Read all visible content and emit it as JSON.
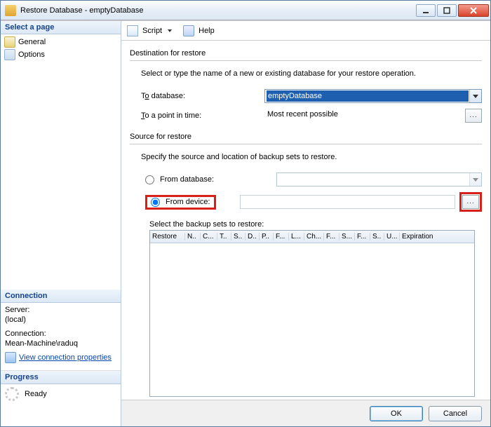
{
  "title": "Restore Database - emptyDatabase",
  "sidebar": {
    "header": "Select a page",
    "items": [
      {
        "label": "General"
      },
      {
        "label": "Options"
      }
    ]
  },
  "connection": {
    "header": "Connection",
    "server_label": "Server:",
    "server_value": "(local)",
    "conn_label": "Connection:",
    "conn_value": "Mean-Machine\\raduq",
    "view_props": "View connection properties"
  },
  "progress": {
    "header": "Progress",
    "status": "Ready"
  },
  "toolbar": {
    "script": "Script",
    "help": "Help"
  },
  "dest": {
    "section": "Destination for restore",
    "instr": "Select or type the name of a new or existing database for your restore operation.",
    "todb_label_pre": "T",
    "todb_label_u": "o",
    "todb_label_post": " database:",
    "todb_value": "emptyDatabase",
    "topit_label_pre": "",
    "topit_label_u": "T",
    "topit_label_post": "o a point in time:",
    "topit_value": "Most recent possible"
  },
  "source": {
    "section": "Source for restore",
    "instr": "Specify the source and location of backup sets to restore.",
    "fromdb_label": "From database:",
    "fromdev_label": "From device:",
    "selected": "device",
    "select_sets_label": "Select the backup sets to restore:"
  },
  "grid": {
    "cols": [
      "Restore",
      "N..",
      "C...",
      "T..",
      "S..",
      "D..",
      "P..",
      "F...",
      "L...",
      "Ch...",
      "F...",
      "S...",
      "F...",
      "S..",
      "U...",
      "Expiration"
    ]
  },
  "buttons": {
    "ok": "OK",
    "cancel": "Cancel"
  }
}
